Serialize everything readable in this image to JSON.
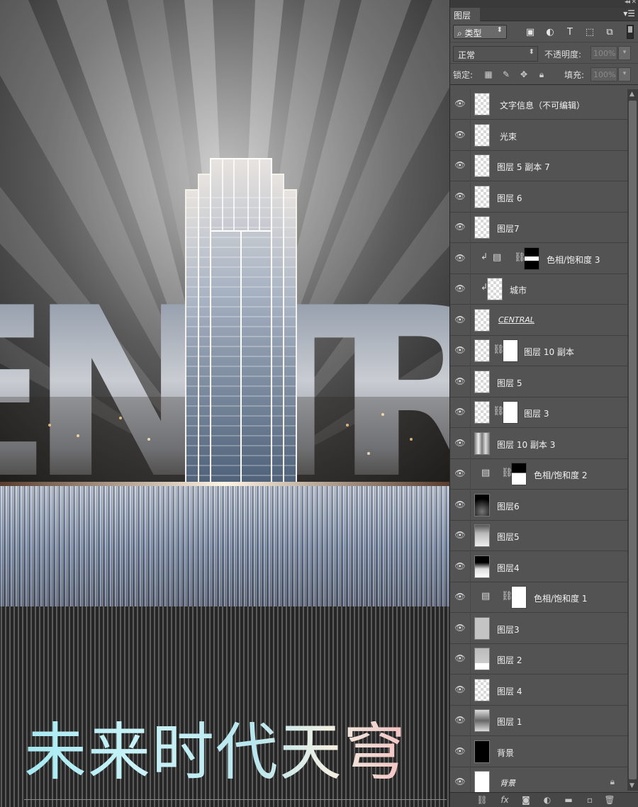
{
  "artwork": {
    "headline": "未来时代天穹",
    "letters": [
      "E",
      "N",
      "T",
      "R"
    ]
  },
  "panel": {
    "tab_label": "图层",
    "menu_icon": "panel-menu-icon",
    "filter": {
      "kind_label": "类型",
      "icons": [
        "image-filter-icon",
        "adjustment-filter-icon",
        "type-filter-icon",
        "shape-filter-icon",
        "smart-object-filter-icon"
      ]
    },
    "blend_mode": "正常",
    "opacity_label": "不透明度:",
    "opacity_value": "100%",
    "lock_label": "锁定:",
    "fill_label": "填充:",
    "fill_value": "100%",
    "layers": [
      {
        "name": "文字信息（不可编辑）",
        "type": "plain"
      },
      {
        "name": "光束",
        "type": "plain"
      },
      {
        "name": "图层 5 副本 7",
        "type": "plain"
      },
      {
        "name": "图层 6",
        "type": "plain"
      },
      {
        "name": "图层7",
        "type": "plain"
      },
      {
        "name": "色相/饱和度 3",
        "type": "adjust-clip"
      },
      {
        "name": "城市",
        "type": "clip"
      },
      {
        "name": "CENTRAL",
        "type": "text"
      },
      {
        "name": "图层 10 副本",
        "type": "mask"
      },
      {
        "name": "图层 5",
        "type": "plain"
      },
      {
        "name": "图层 3",
        "type": "mask"
      },
      {
        "name": "图层 10 副本 3",
        "type": "plain"
      },
      {
        "name": "色相/饱和度 2",
        "type": "adjust"
      },
      {
        "name": "图层6",
        "type": "plain"
      },
      {
        "name": "图层5",
        "type": "plain"
      },
      {
        "name": "图层4",
        "type": "plain"
      },
      {
        "name": "色相/饱和度 1",
        "type": "adjust"
      },
      {
        "name": "图层3",
        "type": "plain"
      },
      {
        "name": "图层 2",
        "type": "plain"
      },
      {
        "name": "图层 4",
        "type": "plain"
      },
      {
        "name": "图层 1",
        "type": "plain"
      },
      {
        "name": "背景",
        "type": "plain"
      },
      {
        "name": "背景",
        "type": "background"
      }
    ],
    "footer_icons": [
      "link-layers-icon",
      "fx-icon",
      "add-mask-icon",
      "new-adjustment-icon",
      "new-group-icon",
      "new-layer-icon",
      "delete-layer-icon"
    ]
  }
}
